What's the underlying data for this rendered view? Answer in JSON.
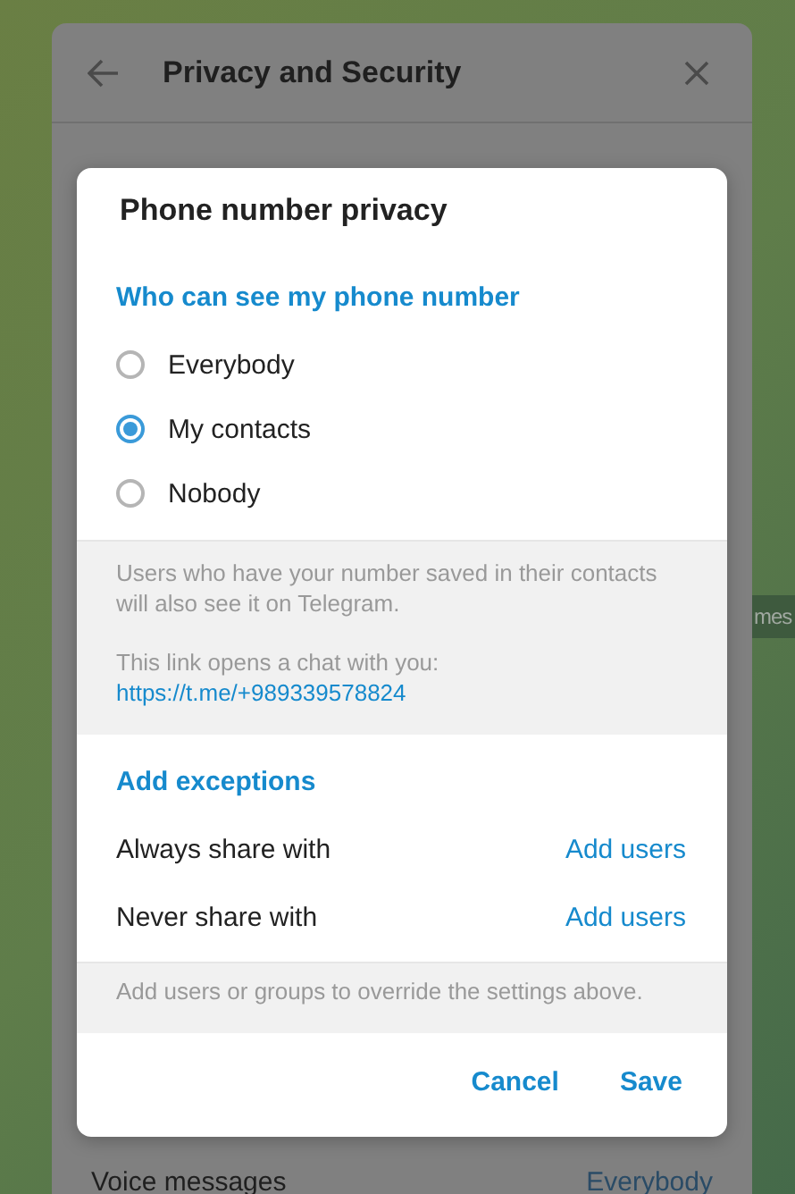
{
  "background": {
    "panel": {
      "title": "Privacy and Security",
      "rows": [
        {
          "label": "Voice messages",
          "value": "Everybody"
        }
      ]
    },
    "chat_fragment": "mes"
  },
  "dialog": {
    "title": "Phone number privacy",
    "section_title": "Who can see my phone number",
    "options": [
      {
        "label": "Everybody",
        "selected": false
      },
      {
        "label": "My contacts",
        "selected": true
      },
      {
        "label": "Nobody",
        "selected": false
      }
    ],
    "info": "Users who have your number saved in their contacts will also see it on Telegram.",
    "link_caption": "This link opens a chat with you:",
    "link": "https://t.me/+989339578824",
    "exceptions_title": "Add exceptions",
    "exceptions": [
      {
        "label": "Always share with",
        "action": "Add users"
      },
      {
        "label": "Never share with",
        "action": "Add users"
      }
    ],
    "exceptions_note": "Add users or groups to override the settings above.",
    "buttons": [
      "Cancel",
      "Save"
    ]
  }
}
